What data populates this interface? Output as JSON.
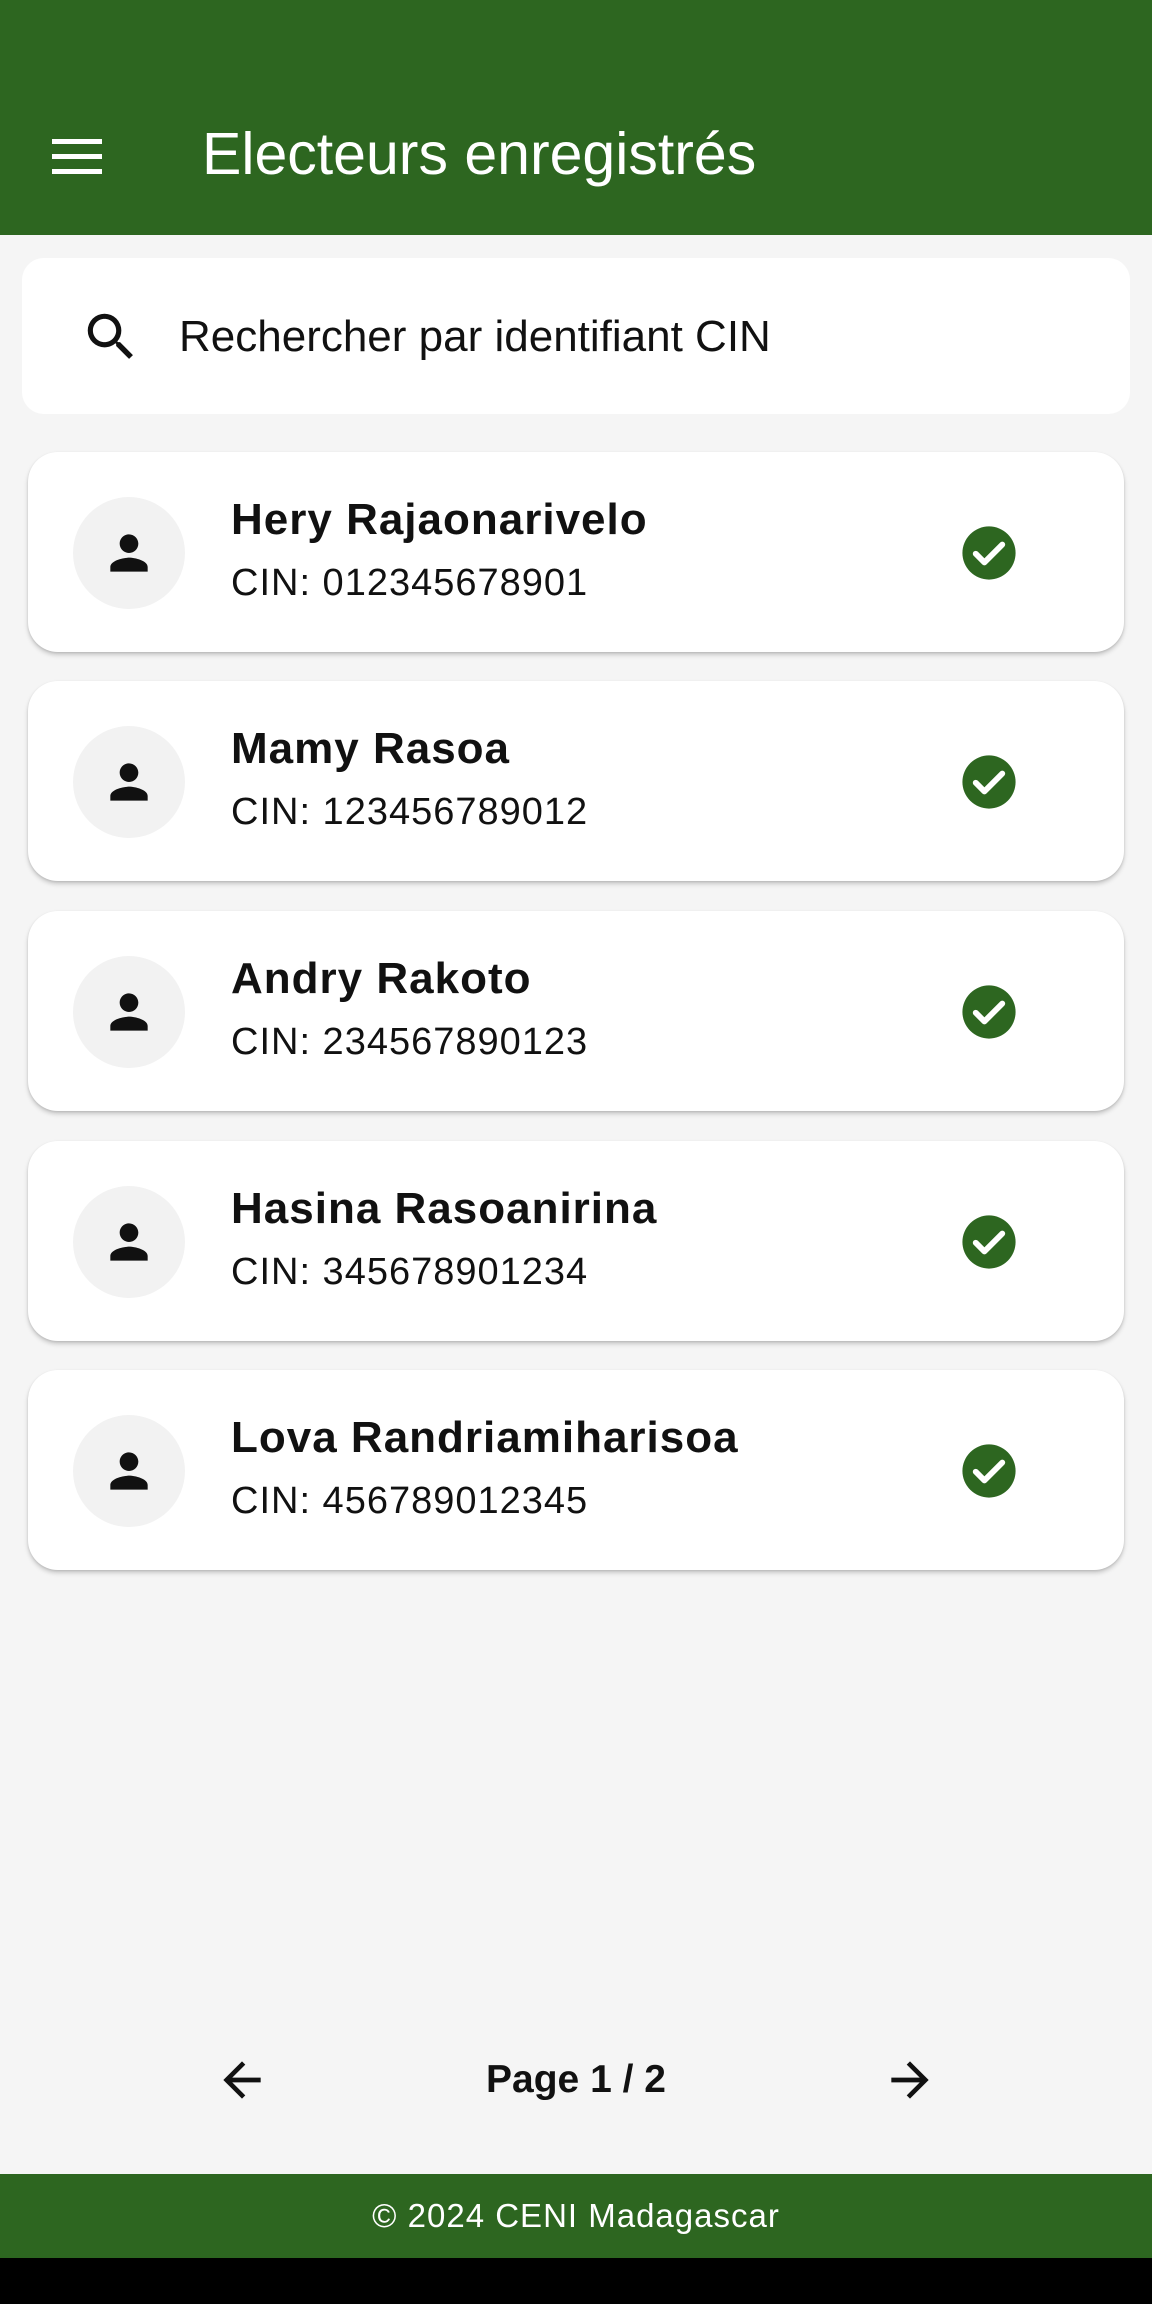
{
  "app_bar": {
    "title": "Electeurs enregistrés",
    "menu_icon": "menu-icon",
    "background": "#2d6620"
  },
  "search": {
    "placeholder": "Rechercher par identifiant CIN",
    "value": "",
    "icon": "search-icon"
  },
  "voters": [
    {
      "name": "Hery Rajaonarivelo",
      "cin": "CIN: 012345678901",
      "status_icon": "check-circle-icon"
    },
    {
      "name": "Mamy Rasoa",
      "cin": "CIN: 123456789012",
      "status_icon": "check-circle-icon"
    },
    {
      "name": "Andry Rakoto",
      "cin": "CIN: 234567890123",
      "status_icon": "check-circle-icon"
    },
    {
      "name": "Hasina Rasoanirina",
      "cin": "CIN: 345678901234",
      "status_icon": "check-circle-icon"
    },
    {
      "name": "Lova Randriamiharisoa",
      "cin": "CIN: 456789012345",
      "status_icon": "check-circle-icon"
    }
  ],
  "pagination": {
    "label": "Page 1 / 2",
    "prev_icon": "arrow-left-icon",
    "next_icon": "arrow-right-icon"
  },
  "footer": {
    "text": "© 2024 CENI Madagascar",
    "background": "#2d6620"
  },
  "colors": {
    "accent": "#2d6620",
    "check": "#2d6620",
    "background": "#f5f5f5"
  }
}
